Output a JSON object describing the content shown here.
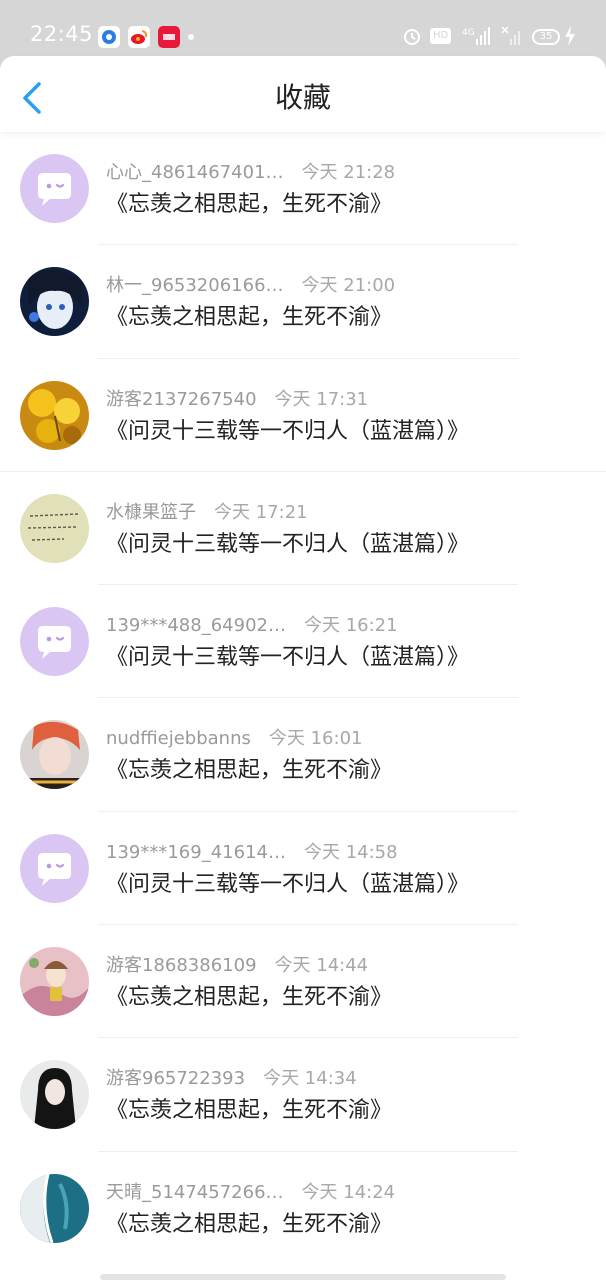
{
  "status_bar": {
    "time": "22:45",
    "hd_label": "HD",
    "network_label": "4G",
    "battery": "35"
  },
  "header": {
    "title": "收藏"
  },
  "items": [
    {
      "user": "心心_4861467401…",
      "time": "今天 21:28",
      "title": "《忘羡之相思起，生死不渝》",
      "avatar": "default-chat-avatar"
    },
    {
      "user": "林一_9653206166…",
      "time": "今天 21:00",
      "title": "《忘羡之相思起，生死不渝》",
      "avatar": "anime-portrait-avatar"
    },
    {
      "user": "游客2137267540",
      "time": "今天 17:31",
      "title": "《问灵十三载等一不归人（蓝湛篇）》",
      "avatar": "yellow-flowers-avatar"
    },
    {
      "user": "水槺果篮子",
      "time": "今天 17:21",
      "title": "《问灵十三载等一不归人（蓝湛篇）》",
      "avatar": "handwriting-note-avatar"
    },
    {
      "user": "139***488_64902…",
      "time": "今天 16:21",
      "title": "《问灵十三载等一不归人（蓝湛篇）》",
      "avatar": "default-chat-avatar"
    },
    {
      "user": "nudffiejebbanns",
      "time": "今天 16:01",
      "title": "《忘羡之相思起，生死不渝》",
      "avatar": "person-photo-avatar"
    },
    {
      "user": "139***169_41614…",
      "time": "今天 14:58",
      "title": "《问灵十三载等一不归人（蓝湛篇）》",
      "avatar": "default-chat-avatar"
    },
    {
      "user": "游客1868386109",
      "time": "今天 14:44",
      "title": "《忘羡之相思起，生死不渝》",
      "avatar": "illustration-avatar"
    },
    {
      "user": "游客965722393",
      "time": "今天 14:34",
      "title": "《忘羡之相思起，生死不渝》",
      "avatar": "dark-hair-girl-avatar"
    },
    {
      "user": "天晴_5147457266…",
      "time": "今天 14:24",
      "title": "《忘羡之相思起，生死不渝》",
      "avatar": "ocean-wave-avatar"
    }
  ],
  "colors": {
    "accent": "#2a9df4",
    "default_avatar_bg": "#d9c6f3"
  }
}
